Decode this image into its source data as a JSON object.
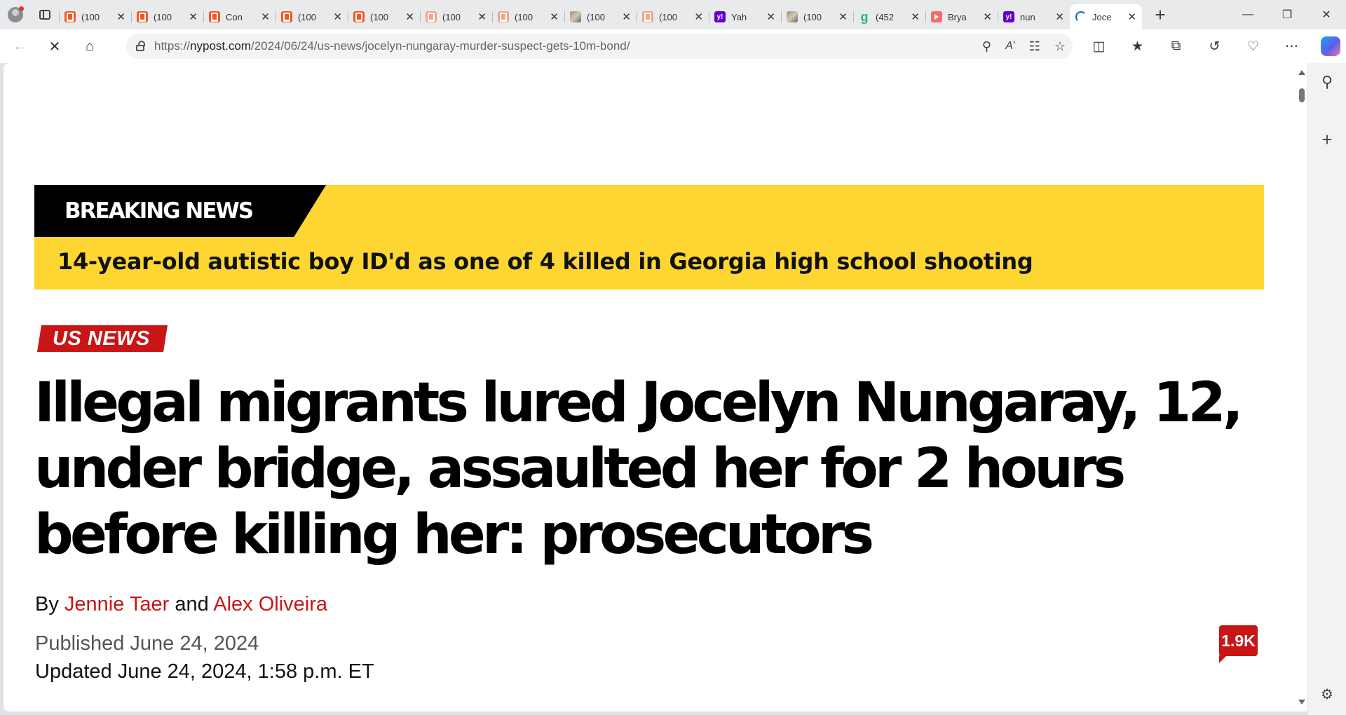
{
  "browser": {
    "tabs": [
      {
        "title": "(100",
        "icon": "orange-bookmark"
      },
      {
        "title": "(100",
        "icon": "orange-bookmark"
      },
      {
        "title": "Con",
        "icon": "orange-bookmark"
      },
      {
        "title": "(100",
        "icon": "orange-bookmark"
      },
      {
        "title": "(100",
        "icon": "orange-bookmark"
      },
      {
        "title": "(100",
        "icon": "pale-bookmark"
      },
      {
        "title": "(100",
        "icon": "pale-bookmark"
      },
      {
        "title": "(100",
        "icon": "photo"
      },
      {
        "title": "(100",
        "icon": "pale-bookmark"
      },
      {
        "title": "Yah",
        "icon": "yahoo"
      },
      {
        "title": "(100",
        "icon": "photo"
      },
      {
        "title": "(452",
        "icon": "green-g"
      },
      {
        "title": "Brya",
        "icon": "youtube"
      },
      {
        "title": "nun",
        "icon": "yahoo"
      },
      {
        "title": "Joce",
        "icon": "loading",
        "active": true
      }
    ],
    "url_scheme": "https://",
    "url_host": "nypost.com",
    "url_path": "/2024/06/24/us-news/jocelyn-nungaray-murder-suspect-gets-10m-bond/",
    "colors": {
      "accent": "#c91515",
      "banner": "#fdd631"
    }
  },
  "article": {
    "breaking_label": "BREAKING NEWS",
    "breaking_headline": "14-year-old autistic boy ID'd as one of 4 killed in Georgia high school shooting",
    "section": "US NEWS",
    "title": "Illegal migrants lured Jocelyn Nungaray, 12, under bridge, assaulted her for 2 hours before killing her: prosecutors",
    "byline_prefix": "By",
    "author_1": "Jennie Taer",
    "byline_conjunction": "and",
    "author_2": "Alex Oliveira",
    "published": "Published June 24, 2024",
    "updated": "Updated June 24, 2024, 1:58 p.m. ET",
    "comment_count": "1.9K"
  }
}
